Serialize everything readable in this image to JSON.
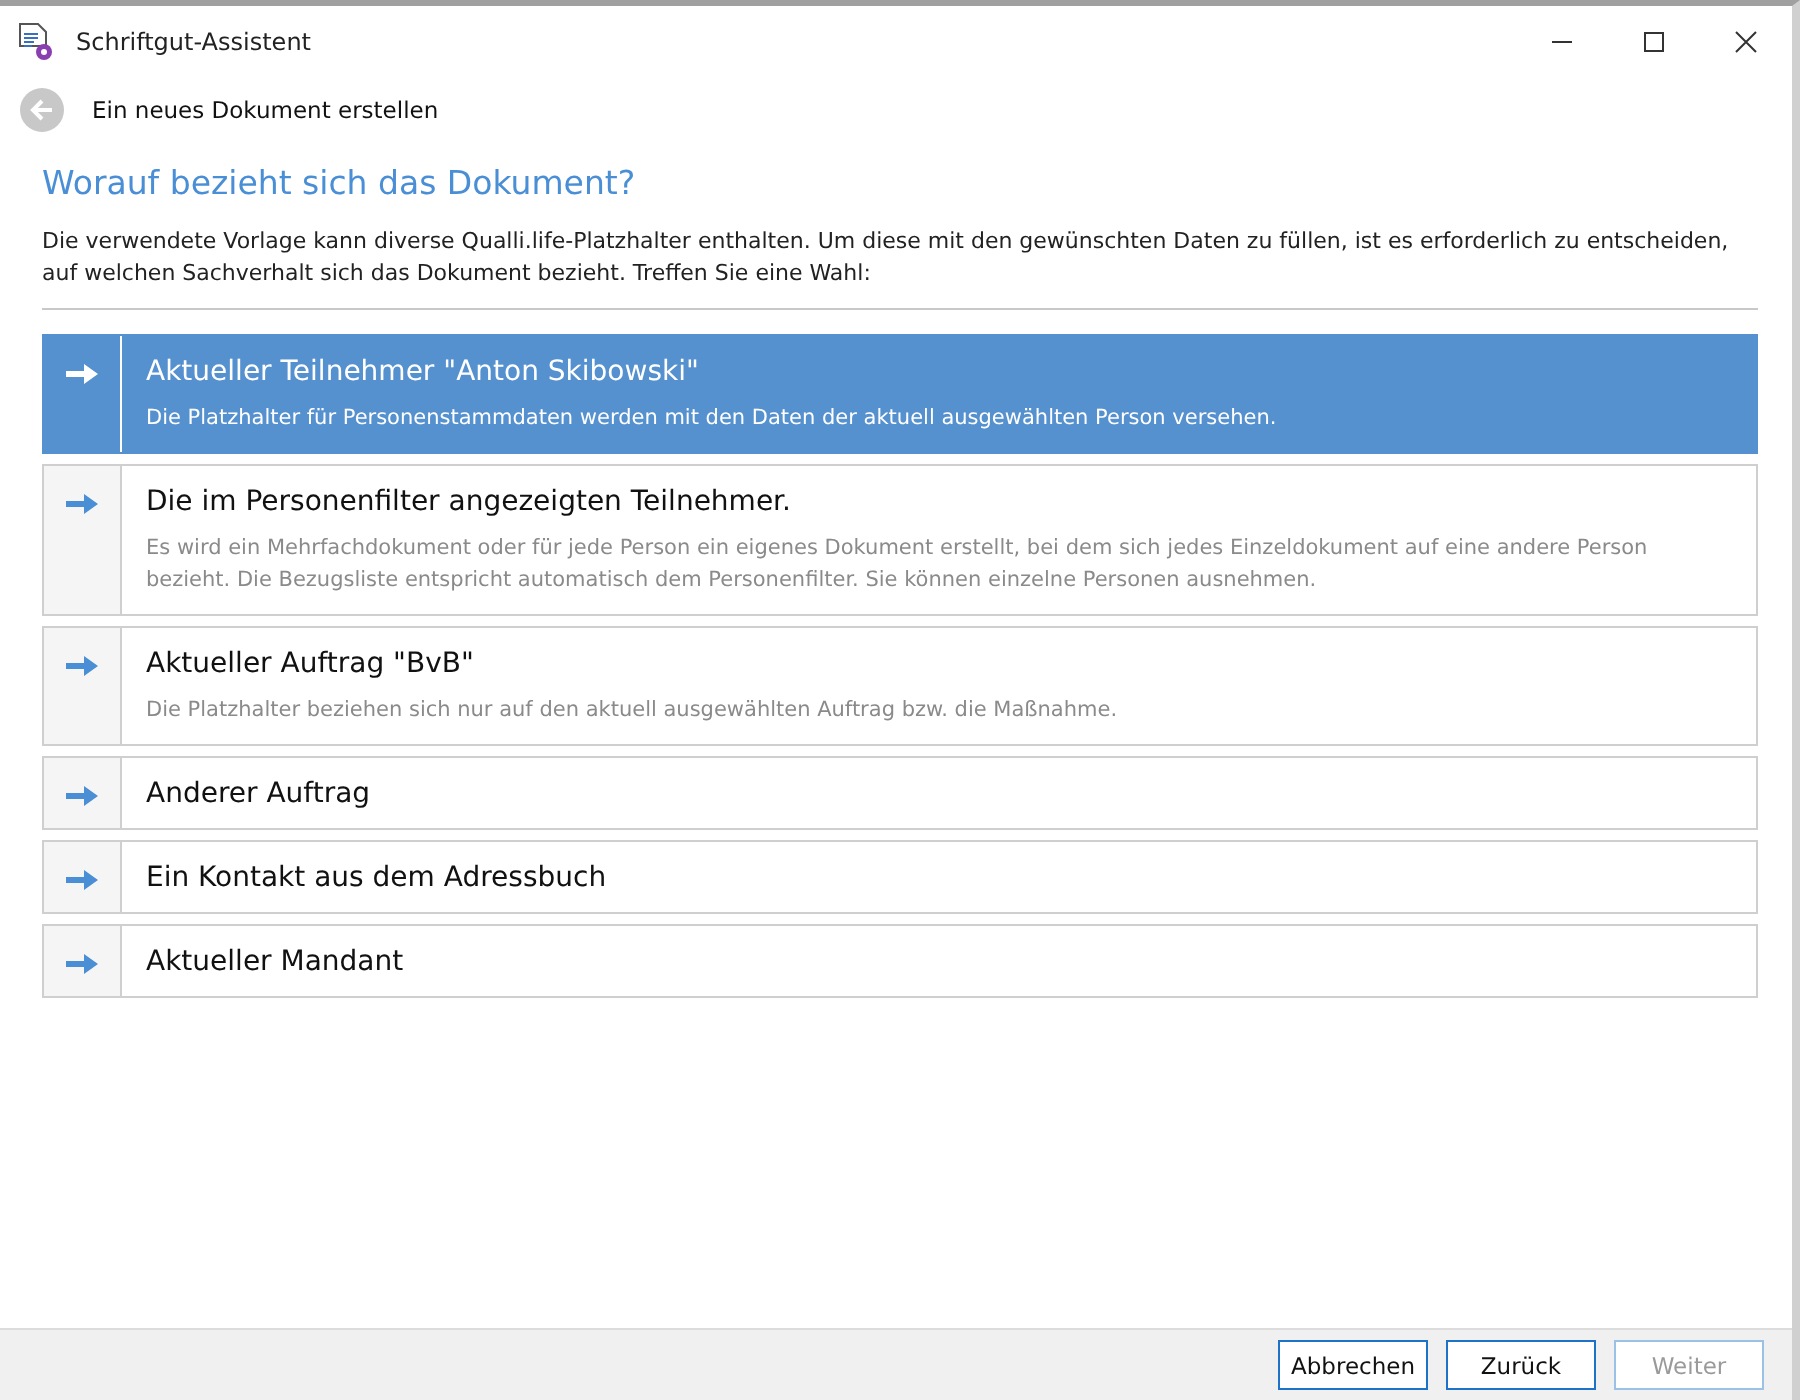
{
  "window": {
    "title": "Schriftgut-Assistent"
  },
  "nav": {
    "title": "Ein neues Dokument erstellen"
  },
  "heading": "Worauf bezieht sich das Dokument?",
  "intro": "Die verwendete Vorlage kann diverse Qualli.life-Platzhalter enthalten. Um diese mit den gewünschten Daten zu füllen, ist es erforderlich zu entscheiden, auf welchen Sachverhalt sich das Dokument bezieht. Treffen Sie eine Wahl:",
  "options": [
    {
      "title": "Aktueller Teilnehmer \"Anton Skibowski\"",
      "description": "Die Platzhalter für Personenstammdaten werden mit den Daten der aktuell ausgewählten Person versehen.",
      "selected": true
    },
    {
      "title": "Die im Personenfilter angezeigten Teilnehmer.",
      "description": "Es wird ein Mehrfachdokument oder für jede Person ein eigenes Dokument erstellt, bei dem sich jedes Einzeldokument auf eine andere Person bezieht. Die Bezugsliste entspricht automatisch dem Personenfilter. Sie können einzelne Personen ausnehmen.",
      "selected": false
    },
    {
      "title": "Aktueller Auftrag \"BvB\"",
      "description": "Die Platzhalter beziehen sich nur auf den aktuell ausgewählten Auftrag bzw. die Maßnahme.",
      "selected": false
    },
    {
      "title": "Anderer Auftrag",
      "selected": false
    },
    {
      "title": "Ein Kontakt aus dem Adressbuch",
      "selected": false
    },
    {
      "title": "Aktueller Mandant",
      "selected": false
    }
  ],
  "buttons": [
    {
      "label": "Abbrechen",
      "disabled": false
    },
    {
      "label": "Zurück",
      "disabled": false
    },
    {
      "label": "Weiter",
      "disabled": true
    }
  ]
}
